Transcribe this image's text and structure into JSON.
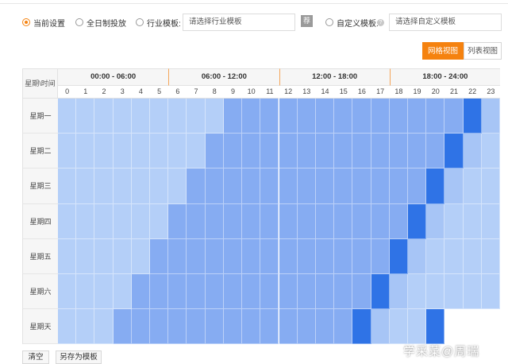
{
  "options": {
    "current": "当前设置",
    "allday": "全日制投放",
    "industry_label": "行业模板:",
    "industry_placeholder": "请选择行业模板",
    "recommend_badge": "荐",
    "custom_label": "自定义模板:",
    "help_icon": "?",
    "custom_placeholder": "请选择自定义模板",
    "selected": "当前设置"
  },
  "view": {
    "grid": "网格视图",
    "list": "列表视图",
    "active": "网格视图"
  },
  "schedule": {
    "corner": "星期\\时间",
    "groups": [
      "00:00 - 06:00",
      "06:00 - 12:00",
      "12:00 - 18:00",
      "18:00 - 24:00"
    ],
    "hours": [
      "0",
      "1",
      "2",
      "3",
      "4",
      "5",
      "6",
      "7",
      "8",
      "9",
      "10",
      "11",
      "12",
      "13",
      "14",
      "15",
      "16",
      "17",
      "18",
      "19",
      "20",
      "21",
      "22",
      "23"
    ],
    "days": [
      "星期一",
      "星期二",
      "星期三",
      "星期四",
      "星期五",
      "星期六",
      "星期天"
    ],
    "colors": {
      "low": "#b4cff8",
      "mid": "#86acf2",
      "high": "#2f73e6",
      "mid_light": "#a7c5f6"
    }
  },
  "footer": {
    "clear": "清空",
    "save_as": "另存为模板"
  },
  "watermark": "学采菜@周瑞"
}
